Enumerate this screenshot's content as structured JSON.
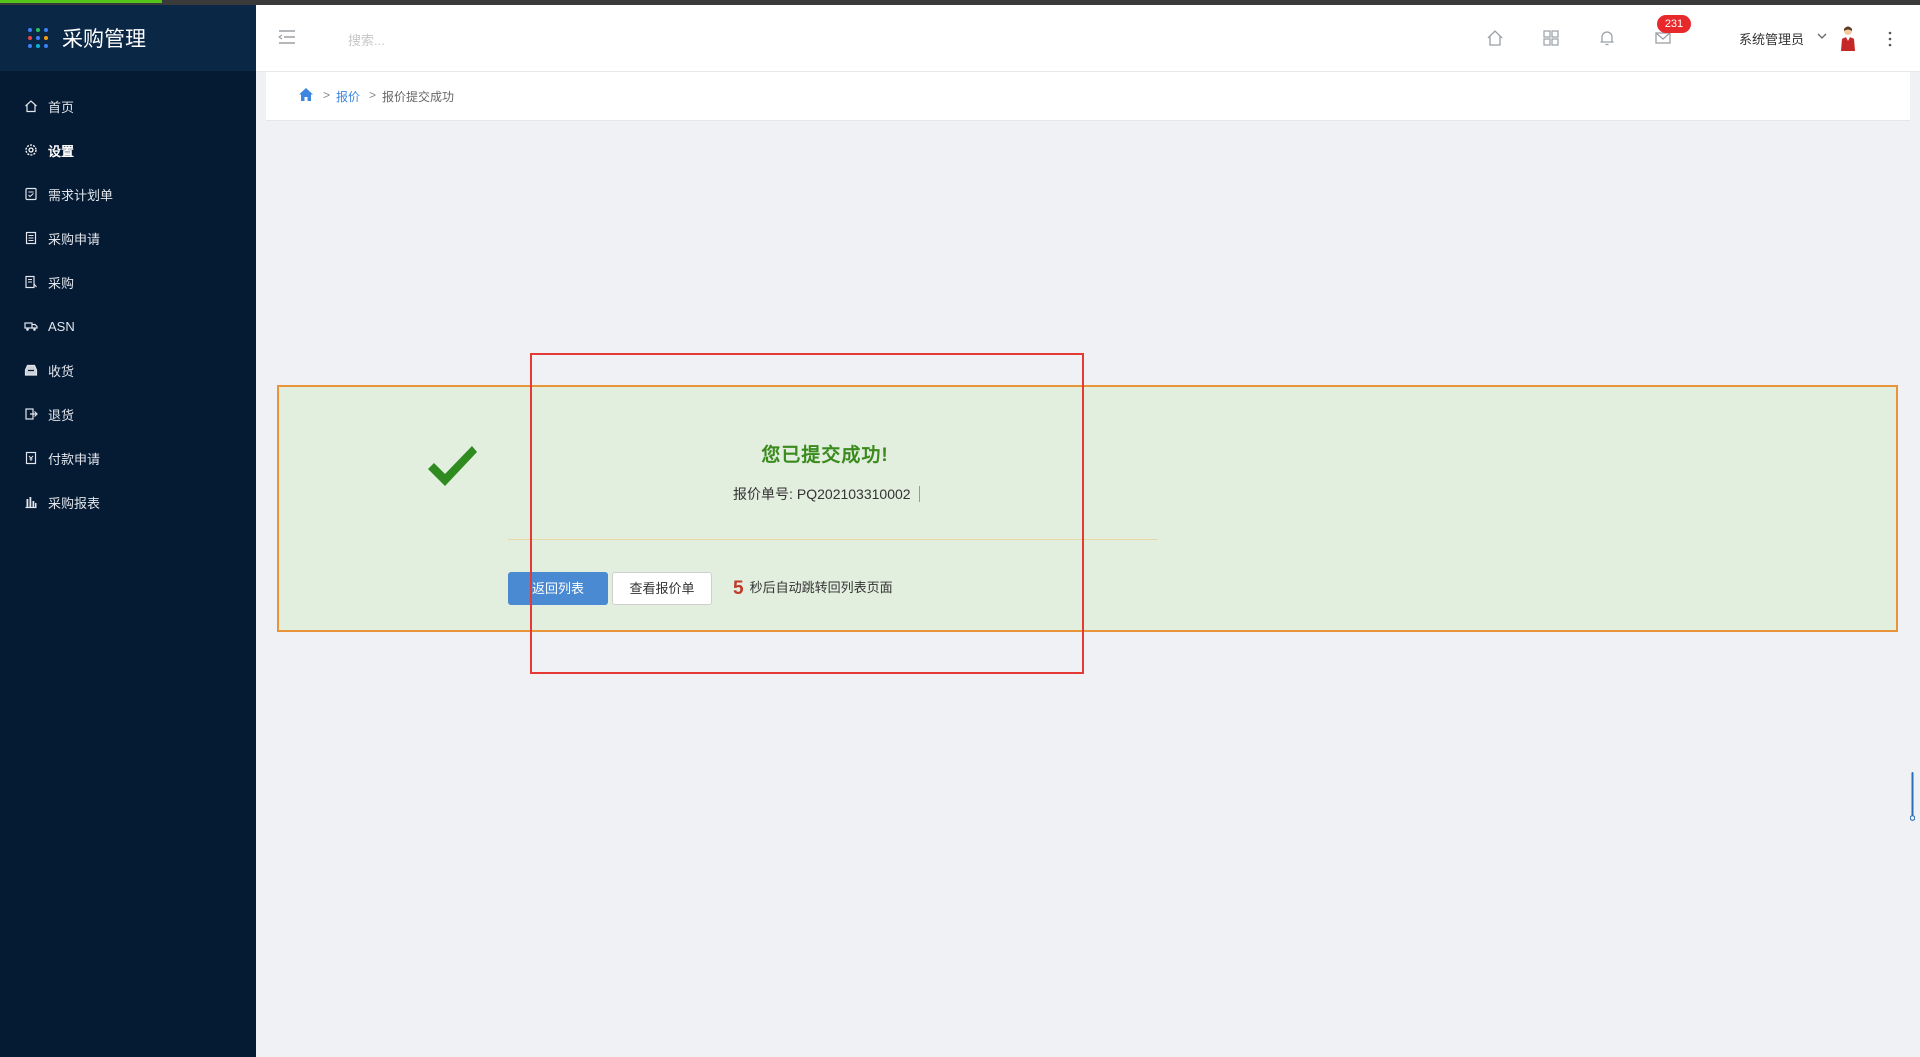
{
  "app": {
    "title": "采购管理",
    "brand_dot_colors": [
      "#3b82f6",
      "#22c55e",
      "#3b82f6",
      "#ef4444",
      "#3b82f6",
      "#f59e0b",
      "#3b82f6",
      "#06b6d4",
      "#3b82f6"
    ]
  },
  "sidebar": {
    "items": [
      {
        "label": "首页",
        "icon": "home-icon"
      },
      {
        "label": "设置",
        "icon": "gear-icon",
        "active": true
      },
      {
        "label": "需求计划单",
        "icon": "plan-icon"
      },
      {
        "label": "采购申请",
        "icon": "document-icon"
      },
      {
        "label": "采购",
        "icon": "list-icon"
      },
      {
        "label": "ASN",
        "icon": "truck-icon"
      },
      {
        "label": "收货",
        "icon": "inbox-icon"
      },
      {
        "label": "退货",
        "icon": "return-icon"
      },
      {
        "label": "付款申请",
        "icon": "payment-icon"
      },
      {
        "label": "采购报表",
        "icon": "bar-chart-icon"
      }
    ]
  },
  "header": {
    "search_placeholder": "搜索...",
    "notification_count": "231",
    "user_name": "系统管理员"
  },
  "breadcrumb": {
    "separator": ">",
    "items": [
      "报价",
      "报价提交成功"
    ]
  },
  "result": {
    "title": "您已提交成功!",
    "number_label": "报价单号:",
    "number_value": "PQ202103310002",
    "back_button": "返回列表",
    "view_button": "查看报价单",
    "countdown_seconds": "5",
    "countdown_text": "秒后自动跳转回列表页面"
  },
  "colors": {
    "sidebar_bg": "#051a33",
    "success_green": "#3a8a1d",
    "primary_blue": "#4a8ad2",
    "badge_red": "#e8292c",
    "annotation_red": "#e53935",
    "card_border": "#e8943a"
  }
}
